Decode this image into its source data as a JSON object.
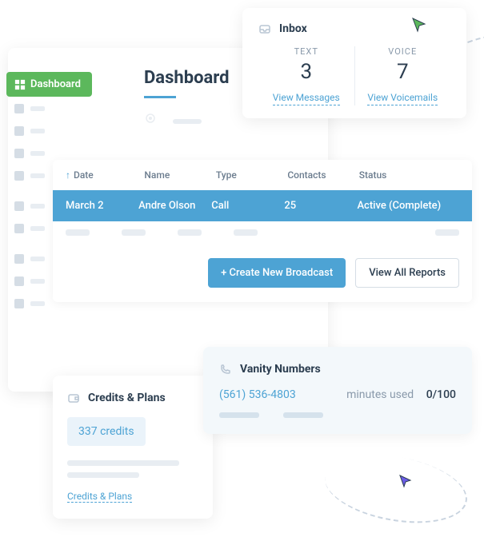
{
  "dashboard": {
    "badge": "Dashboard",
    "title": "Dashboard"
  },
  "inbox": {
    "title": "Inbox",
    "text": {
      "label": "TEXT",
      "count": "3",
      "link": "View Messages"
    },
    "voice": {
      "label": "VOICE",
      "count": "7",
      "link": "View Voicemails"
    }
  },
  "table": {
    "headers": {
      "date": "Date",
      "name": "Name",
      "type": "Type",
      "contacts": "Contacts",
      "status": "Status"
    },
    "row": {
      "date": "March 2",
      "name": "Andre Olson",
      "type": "Call",
      "contacts": "25",
      "status": "Active (Complete)"
    },
    "create": "+ Create New Broadcast",
    "viewall": "View All Reports"
  },
  "credits": {
    "title": "Credits & Plans",
    "pill": "337 credits",
    "link": "Credits & Plans"
  },
  "vanity": {
    "title": "Vanity Numbers",
    "phone": "(561) 536-4803",
    "usage_label": "minutes used",
    "usage_val": "0/100"
  }
}
